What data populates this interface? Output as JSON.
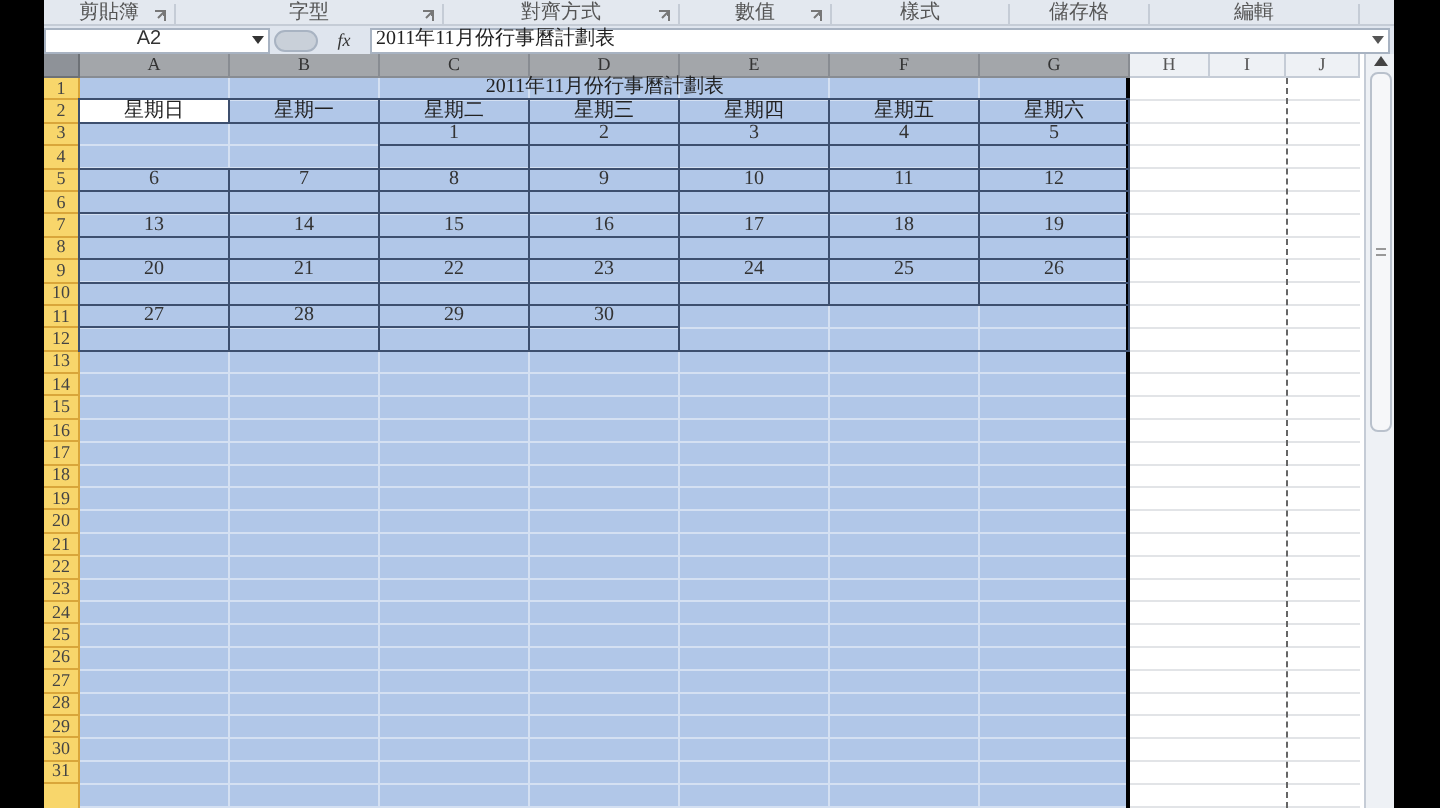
{
  "ribbon_groups": [
    {
      "label": "剪貼簿",
      "launcher": true
    },
    {
      "label": "字型",
      "launcher": true
    },
    {
      "label": "對齊方式",
      "launcher": true
    },
    {
      "label": "數值",
      "launcher": true
    },
    {
      "label": "樣式",
      "launcher": false
    },
    {
      "label": "儲存格",
      "launcher": false
    },
    {
      "label": "編輯",
      "launcher": false
    }
  ],
  "name_box": "A2",
  "formula_bar": {
    "fx": "fx",
    "value": "2011年11月份行事曆計劃表"
  },
  "column_headers": [
    {
      "label": "A",
      "selected": true
    },
    {
      "label": "B",
      "selected": true
    },
    {
      "label": "C",
      "selected": true
    },
    {
      "label": "D",
      "selected": true
    },
    {
      "label": "E",
      "selected": true
    },
    {
      "label": "F",
      "selected": true
    },
    {
      "label": "G",
      "selected": true
    },
    {
      "label": "H",
      "selected": false
    },
    {
      "label": "I",
      "selected": false
    },
    {
      "label": "J",
      "selected": false
    }
  ],
  "row_headers": [
    "1",
    "2",
    "3",
    "4",
    "5",
    "6",
    "7",
    "8",
    "9",
    "10",
    "11",
    "12",
    "13",
    "14",
    "15",
    "16",
    "17",
    "18",
    "19",
    "20",
    "21",
    "22",
    "23",
    "24",
    "25",
    "26",
    "27",
    "28",
    "29",
    "30",
    "31"
  ],
  "calendar": {
    "title": "2011年11月份行事曆計劃表",
    "weekdays": [
      {
        "label": "星期日",
        "active": true
      },
      {
        "label": "星期一",
        "active": false
      },
      {
        "label": "星期二",
        "active": false
      },
      {
        "label": "星期三",
        "active": false
      },
      {
        "label": "星期四",
        "active": false
      },
      {
        "label": "星期五",
        "active": false
      },
      {
        "label": "星期六",
        "active": false
      }
    ],
    "weeks": [
      {
        "kind": "lead",
        "days": [
          "1",
          "2",
          "3",
          "4",
          "5"
        ]
      },
      {
        "kind": "full",
        "days": [
          "6",
          "7",
          "8",
          "9",
          "10",
          "11",
          "12"
        ]
      },
      {
        "kind": "full",
        "days": [
          "13",
          "14",
          "15",
          "16",
          "17",
          "18",
          "19"
        ]
      },
      {
        "kind": "full",
        "days": [
          "20",
          "21",
          "22",
          "23",
          "24",
          "25",
          "26"
        ]
      },
      {
        "kind": "trail",
        "days": [
          "27",
          "28",
          "29",
          "30"
        ]
      }
    ]
  }
}
